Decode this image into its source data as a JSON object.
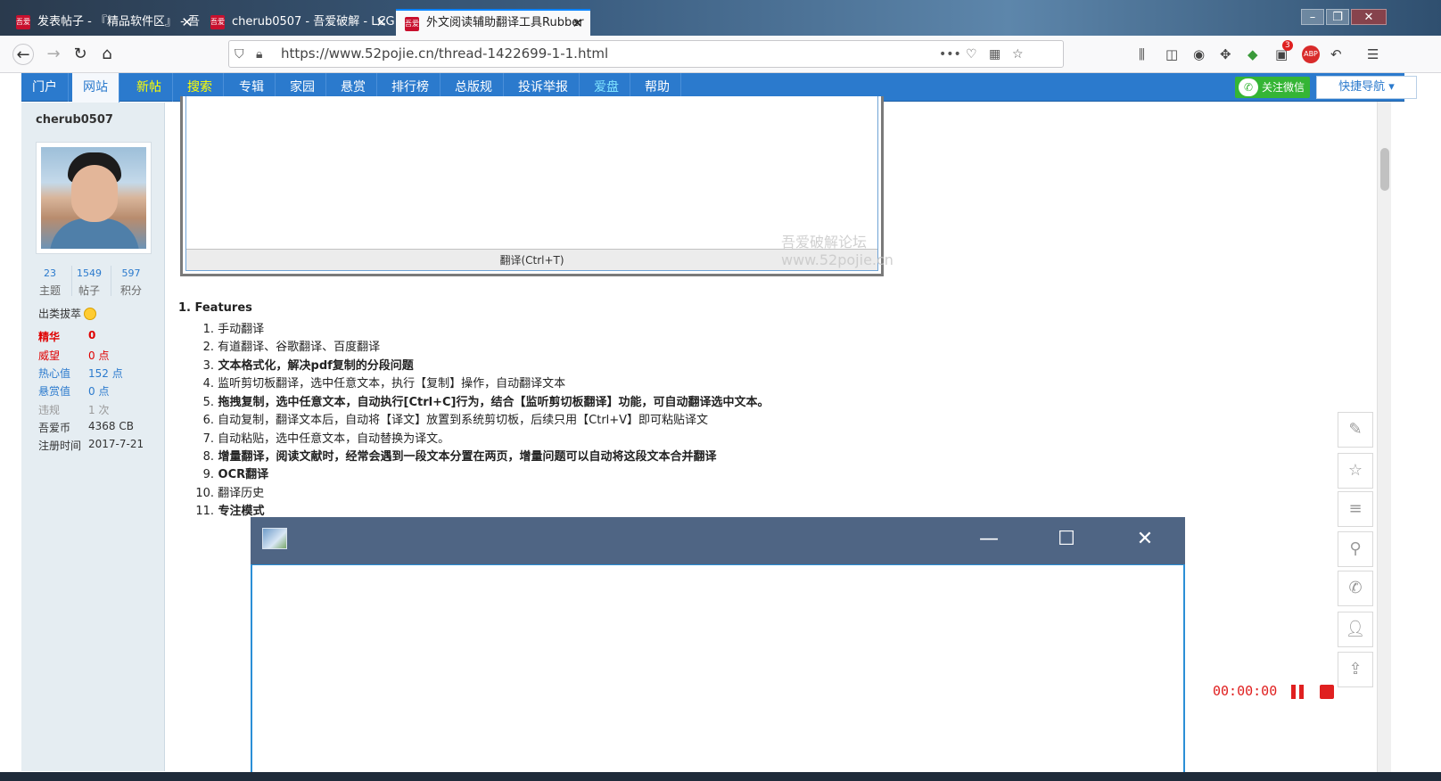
{
  "browser": {
    "tabs": [
      {
        "title": "发表帖子 - 『精品软件区』 - 吾",
        "favicon": "52pojie-favicon"
      },
      {
        "title": "cherub0507 - 吾爱破解 - LCG",
        "favicon": "52pojie-favicon"
      },
      {
        "title": "外文阅读辅助翻译工具Rubber",
        "favicon": "52pojie-favicon",
        "active": true
      }
    ],
    "url": "https://www.52pojie.cn/thread-1422699-1-1.html",
    "window_controls": [
      "minimize-icon",
      "restore-icon",
      "close-icon"
    ],
    "toolbar_icons": [
      "library-icon",
      "sidebar-icon",
      "account-icon",
      "extension-icon",
      "globe-icon",
      "badge-extension-icon",
      "adblock-icon",
      "back-arrow-icon",
      "menu-icon"
    ],
    "badge_count": "3",
    "adblock_label": "ABP"
  },
  "site_nav": {
    "items": [
      {
        "label": "门户",
        "style": "normal"
      },
      {
        "label": "网站",
        "style": "active"
      },
      {
        "label": "新帖",
        "style": "yellow"
      },
      {
        "label": "搜索",
        "style": "yellow"
      },
      {
        "label": "专辑",
        "style": "normal"
      },
      {
        "label": "家园",
        "style": "normal"
      },
      {
        "label": "悬赏",
        "style": "normal"
      },
      {
        "label": "排行榜",
        "style": "normal"
      },
      {
        "label": "总版规",
        "style": "normal"
      },
      {
        "label": "投诉举报",
        "style": "normal"
      },
      {
        "label": "爱盘",
        "style": "cyan"
      },
      {
        "label": "帮助",
        "style": "normal"
      }
    ],
    "follow_wechat": "关注微信",
    "quick_nav": "快捷导航 ▾"
  },
  "sidebar": {
    "username": "cherub0507",
    "stats": [
      {
        "value": "23",
        "label": "主题"
      },
      {
        "value": "1549",
        "label": "帖子"
      },
      {
        "value": "597",
        "label": "积分"
      }
    ],
    "rank": "出类拔萃",
    "profile": [
      {
        "key": "精华",
        "value": "0",
        "color": "#e00000",
        "bold": true
      },
      {
        "key": "威望",
        "value": "0 点",
        "color": "#e00000"
      },
      {
        "key": "热心值",
        "value": "152 点",
        "color": "#2b7acd"
      },
      {
        "key": "悬赏值",
        "value": "0 点",
        "color": "#2b7acd"
      },
      {
        "key": "违规",
        "value": "1 次",
        "color": "#999999"
      },
      {
        "key": "吾爱币",
        "value": "4368 CB",
        "color": "#333333"
      },
      {
        "key": "注册时间",
        "value": "2017-7-21",
        "color": "#333333"
      }
    ]
  },
  "screenshot_embed": {
    "translate_button": "翻译(Ctrl+T)",
    "watermark_line1": "吾爱破解论坛",
    "watermark_line2": "www.52pojie.cn"
  },
  "features": {
    "heading": "1. Features",
    "items": [
      {
        "num": "1.",
        "text": "手动翻译",
        "bold": false
      },
      {
        "num": "2.",
        "text": "有道翻译、谷歌翻译、百度翻译",
        "bold": false
      },
      {
        "num": "3.",
        "text": "文本格式化，解决pdf复制的分段问题",
        "bold": true
      },
      {
        "num": "4.",
        "text": "监听剪切板翻译，选中任意文本，执行【复制】操作，自动翻译文本",
        "bold": false
      },
      {
        "num": "5.",
        "text": "拖拽复制，选中任意文本，自动执行[Ctrl+C]行为，结合【监听剪切板翻译】功能，可自动翻译选中文本。",
        "bold": true
      },
      {
        "num": "6.",
        "text": "自动复制，翻译文本后，自动将【译文】放置到系统剪切板，后续只用【Ctrl+V】即可粘贴译文",
        "bold": false
      },
      {
        "num": "7.",
        "text": "自动粘贴，选中任意文本，自动替换为译文。",
        "bold": false
      },
      {
        "num": "8.",
        "text": "增量翻译，阅读文献时，经常会遇到一段文本分置在两页，增量问题可以自动将这段文本合并翻译",
        "bold": true
      },
      {
        "num": "9.",
        "text": "OCR翻译",
        "bold": true
      },
      {
        "num": "10.",
        "text": "翻译历史",
        "bold": false
      },
      {
        "num": "11.",
        "text": "专注模式",
        "bold": true
      }
    ]
  },
  "app_window": {
    "controls": [
      "minimize-icon",
      "maximize-icon",
      "close-icon"
    ],
    "title_color": "#4f6584",
    "border_color": "#2b8fd6"
  },
  "right_tools": [
    "edit-icon",
    "star-icon",
    "list-icon",
    "search-icon",
    "wechat-icon",
    "user-icon",
    "back-to-top-icon"
  ],
  "recorder": {
    "time": "00:00:00"
  }
}
